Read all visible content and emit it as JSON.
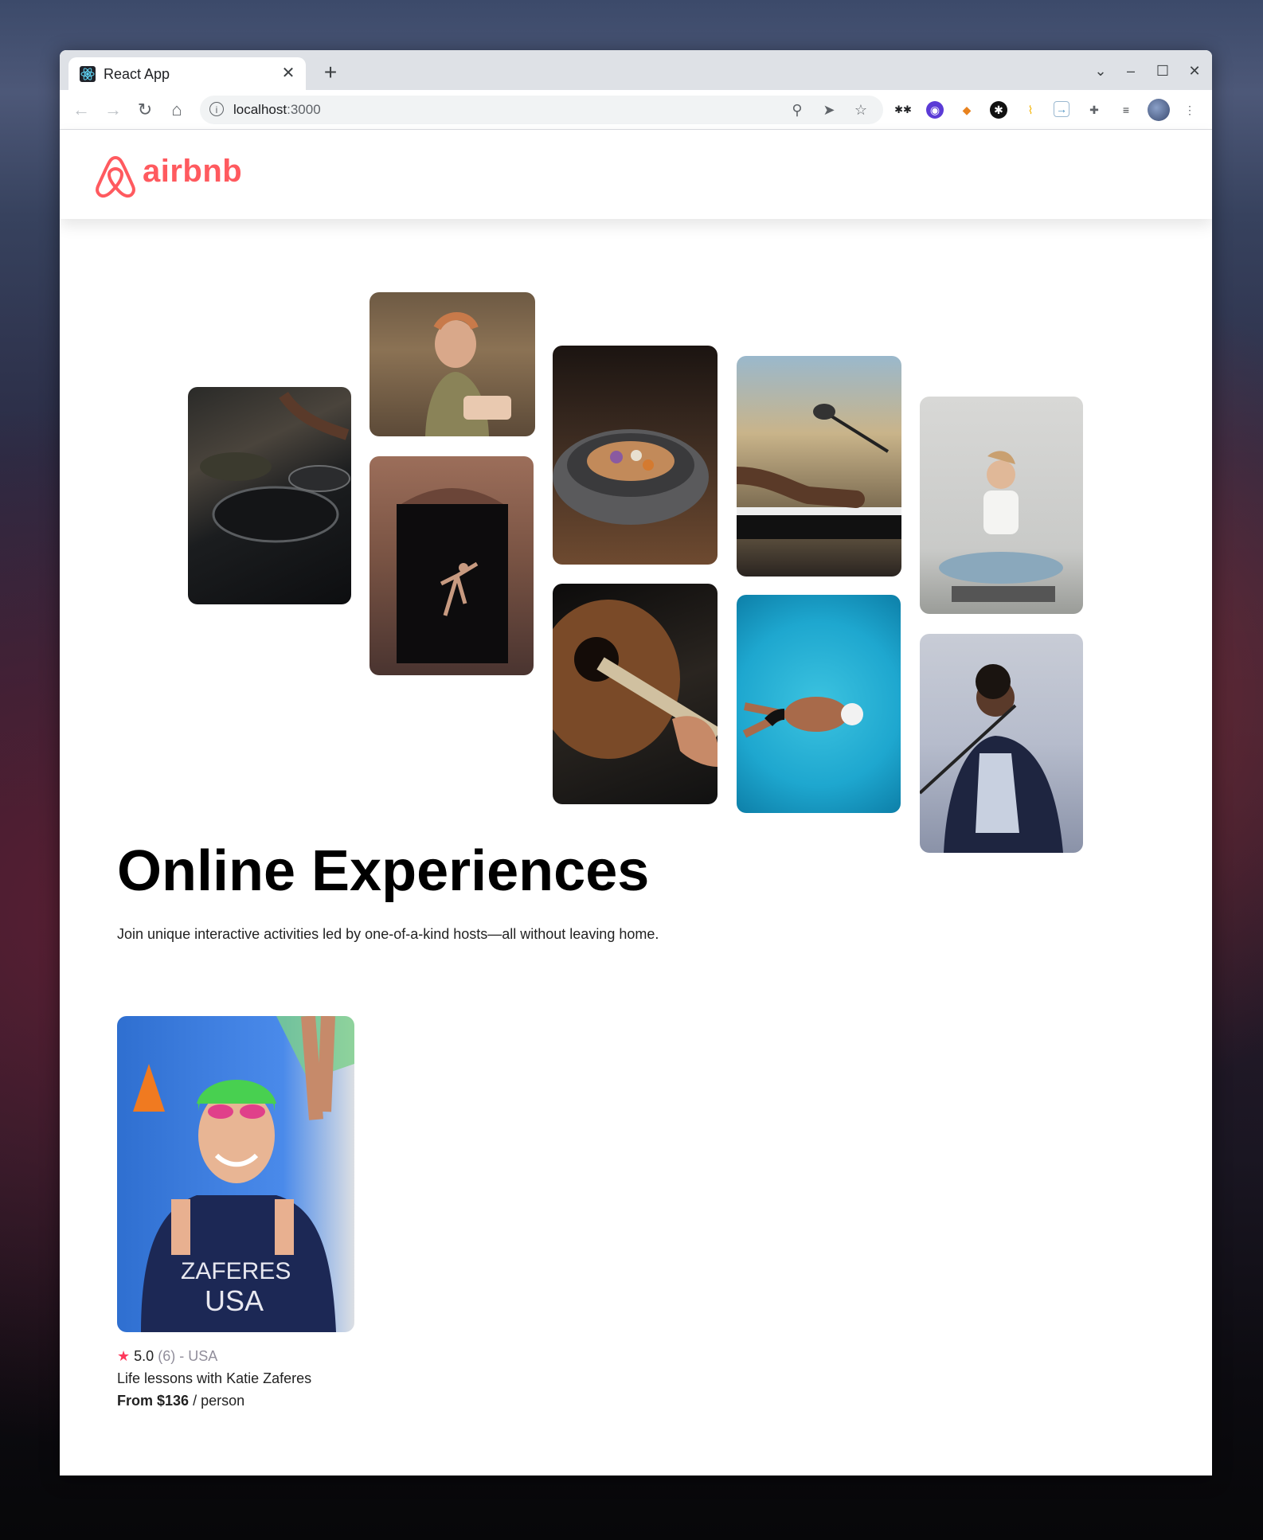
{
  "browser": {
    "tab_title": "React App",
    "url_host": "localhost",
    "url_path": ":3000"
  },
  "brand": {
    "name": "airbnb",
    "color": "#FF5A5F"
  },
  "hero": {
    "title": "Online Experiences",
    "subtitle": "Join unique interactive activities led by one-of-a-kind hosts—all without leaving home."
  },
  "cards": [
    {
      "rating": "5.0",
      "review_count": "(6)",
      "location_sep": "·",
      "location": "USA",
      "title": "Life lessons with Katie Zaferes",
      "price_prefix": "From $136",
      "price_suffix": "/ person"
    }
  ],
  "card_photo_text": "ZAFERES USA"
}
